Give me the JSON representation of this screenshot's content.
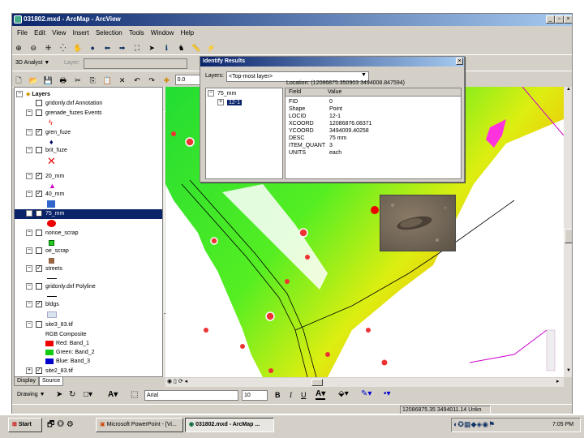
{
  "window": {
    "title": "031802.mxd - ArcMap - ArcView",
    "buttons": [
      "_",
      "▫",
      "×"
    ]
  },
  "menu": [
    "File",
    "Edit",
    "View",
    "Insert",
    "Selection",
    "Tools",
    "Window",
    "Help"
  ],
  "toolbar3": {
    "analyst_label": "3D Analyst ▼",
    "layer_label": "Layer:",
    "scale": "0.0"
  },
  "toc": {
    "root": "Layers",
    "layers": [
      {
        "name": "gridonly.dxf Annotation",
        "checked": false
      },
      {
        "name": "grenade_fuzes Events",
        "checked": false
      },
      {
        "name": "gren_fuze",
        "checked": true
      },
      {
        "name": "brit_fuze",
        "checked": false
      },
      {
        "name": "20_mm",
        "checked": true
      },
      {
        "name": "40_mm",
        "checked": true
      },
      {
        "name": "75_mm",
        "checked": true
      },
      {
        "name": "nonoe_scrap",
        "checked": false
      },
      {
        "name": "oe_scrap",
        "checked": false
      },
      {
        "name": "streets",
        "checked": true
      },
      {
        "name": "gridonly.dxf Polyline",
        "checked": false
      },
      {
        "name": "bldgs",
        "checked": true
      },
      {
        "name": "site3_83.tif",
        "checked": false
      },
      {
        "name": "site2_83.tif",
        "checked": true
      }
    ],
    "rgb": {
      "title": "RGB Composite",
      "red": "Red:",
      "red_band": "Band_1",
      "green": "Green:",
      "green_band": "Band_2",
      "blue": "Blue:",
      "blue_band": "Band_3"
    },
    "tabs": [
      "Display",
      "Source"
    ]
  },
  "identify": {
    "title": "Identify Results",
    "layers_label": "Layers:",
    "layers_value": "<Top-most layer>",
    "tree_root": "75_mm",
    "tree_child": "12-1",
    "location": "Location: (12086875.350903 3494008.847594)",
    "col_field": "Field",
    "col_value": "Value",
    "rows": [
      {
        "f": "FID",
        "v": "0"
      },
      {
        "f": "Shape",
        "v": "Point"
      },
      {
        "f": "LOCID",
        "v": "12-1"
      },
      {
        "f": "XCOORD",
        "v": "12086876.08371"
      },
      {
        "f": "YCOORD",
        "v": "3494009.40258"
      },
      {
        "f": "DESC",
        "v": "75 mm"
      },
      {
        "f": "ITEM_QUANT",
        "v": "3"
      },
      {
        "f": "UNITS",
        "v": "each"
      }
    ]
  },
  "drawing": {
    "label": "Drawing ▼",
    "font": "Arial",
    "size": "10",
    "bold": "B",
    "italic": "I",
    "underline": "U"
  },
  "status": {
    "coords": "12086875.35  3494011.14 Unkn"
  },
  "taskbar": {
    "start": "Start",
    "task1": "Microsoft PowerPoint - [Vi...",
    "task2": "031802.mxd - ArcMap ...",
    "clock": "7:05 PM"
  }
}
